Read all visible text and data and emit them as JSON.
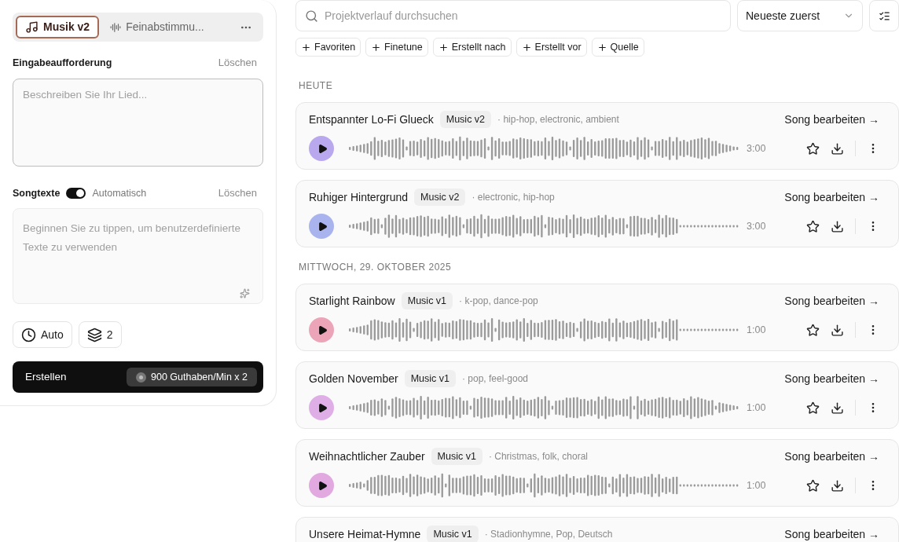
{
  "sidebar": {
    "tabs": [
      {
        "label": "Musik v2",
        "selected": true,
        "kind": "music"
      },
      {
        "label": "Feinabstimmu...",
        "selected": false,
        "kind": "tune"
      }
    ],
    "prompt": {
      "label": "Eingabeaufforderung",
      "clear": "Löschen",
      "placeholder": "Beschreiben Sie Ihr Lied..."
    },
    "lyrics": {
      "label": "Songtexte",
      "toggle_on": true,
      "toggle_label": "Automatisch",
      "clear": "Löschen",
      "placeholder": "Beginnen Sie zu tippen, um benutzerdefinierte Texte zu verwenden"
    },
    "options": [
      {
        "kind": "duration",
        "label": "Auto"
      },
      {
        "kind": "variants",
        "label": "2"
      }
    ],
    "create": {
      "label": "Erstellen",
      "cost": "900 Guthaben/Min x 2"
    }
  },
  "search": {
    "placeholder": "Projektverlauf durchsuchen"
  },
  "sort": {
    "value": "Neueste zuerst"
  },
  "filters": [
    "Favoriten",
    "Finetune",
    "Erstellt nach",
    "Erstellt vor",
    "Quelle"
  ],
  "sections": [
    {
      "heading": "HEUTE",
      "songs": [
        {
          "title": "Entspannter Lo-Fi Glueck",
          "model": "Music v2",
          "tags": "· hip-hop, electronic, ambient",
          "duration": "3:00",
          "edit": "Song bearbeiten →",
          "color": "#b9a8ee"
        },
        {
          "title": "Ruhiger Hintergrund",
          "model": "Music v2",
          "tags": "· electronic, hip-hop",
          "duration": "3:00",
          "edit": "Song bearbeiten →",
          "color": "#a9b4ee"
        }
      ]
    },
    {
      "heading": "MITTWOCH, 29. OKTOBER 2025",
      "songs": [
        {
          "title": "Starlight Rainbow",
          "model": "Music v1",
          "tags": "· k-pop, dance-pop",
          "duration": "1:00",
          "edit": "Song bearbeiten →",
          "color": "#eba4b8"
        },
        {
          "title": "Golden November",
          "model": "Music v1",
          "tags": "· pop, feel-good",
          "duration": "1:00",
          "edit": "Song bearbeiten →",
          "color": "#e0aee6"
        },
        {
          "title": "Weihnachtlicher Zauber",
          "model": "Music v1",
          "tags": "· Christmas, folk, choral",
          "duration": "1:00",
          "edit": "Song bearbeiten →",
          "color": "#e2a8e0"
        },
        {
          "title": "Unsere Heimat-Hymne",
          "model": "Music v1",
          "tags": "· Stadionhymne, Pop, Deutsch",
          "edit": "Song bearbeiten →"
        }
      ]
    }
  ]
}
